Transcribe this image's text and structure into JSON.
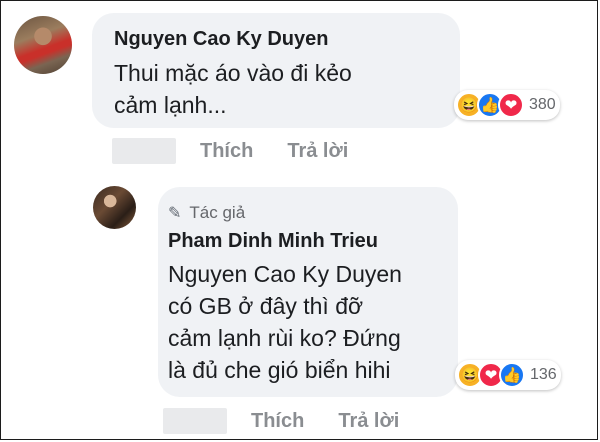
{
  "comments": [
    {
      "author": "Nguyen Cao Ky Duyen",
      "lines": [
        "Thui mặc áo vào đi kẻo",
        "cảm lạnh..."
      ],
      "reaction_count": "380",
      "actions": {
        "like": "Thích",
        "reply": "Trả lời"
      }
    },
    {
      "tag": "Tác giả",
      "author": "Pham Dinh Minh Trieu",
      "mention": "Nguyen Cao Ky Duyen",
      "lines": [
        "có GB ở đây thì đỡ",
        "cảm lạnh rùi ko? Đứng",
        "là đủ che gió biển hihi"
      ],
      "reaction_count": "136",
      "actions": {
        "like": "Thích",
        "reply": "Trả lời"
      }
    }
  ],
  "icons": {
    "haha": "😆",
    "like": "👍",
    "love": "❤",
    "pencil": "✎"
  },
  "colors": {
    "bubble": "#f0f2f5",
    "like": "#1877f2",
    "love": "#f0284a",
    "haha": "#f7b125"
  }
}
